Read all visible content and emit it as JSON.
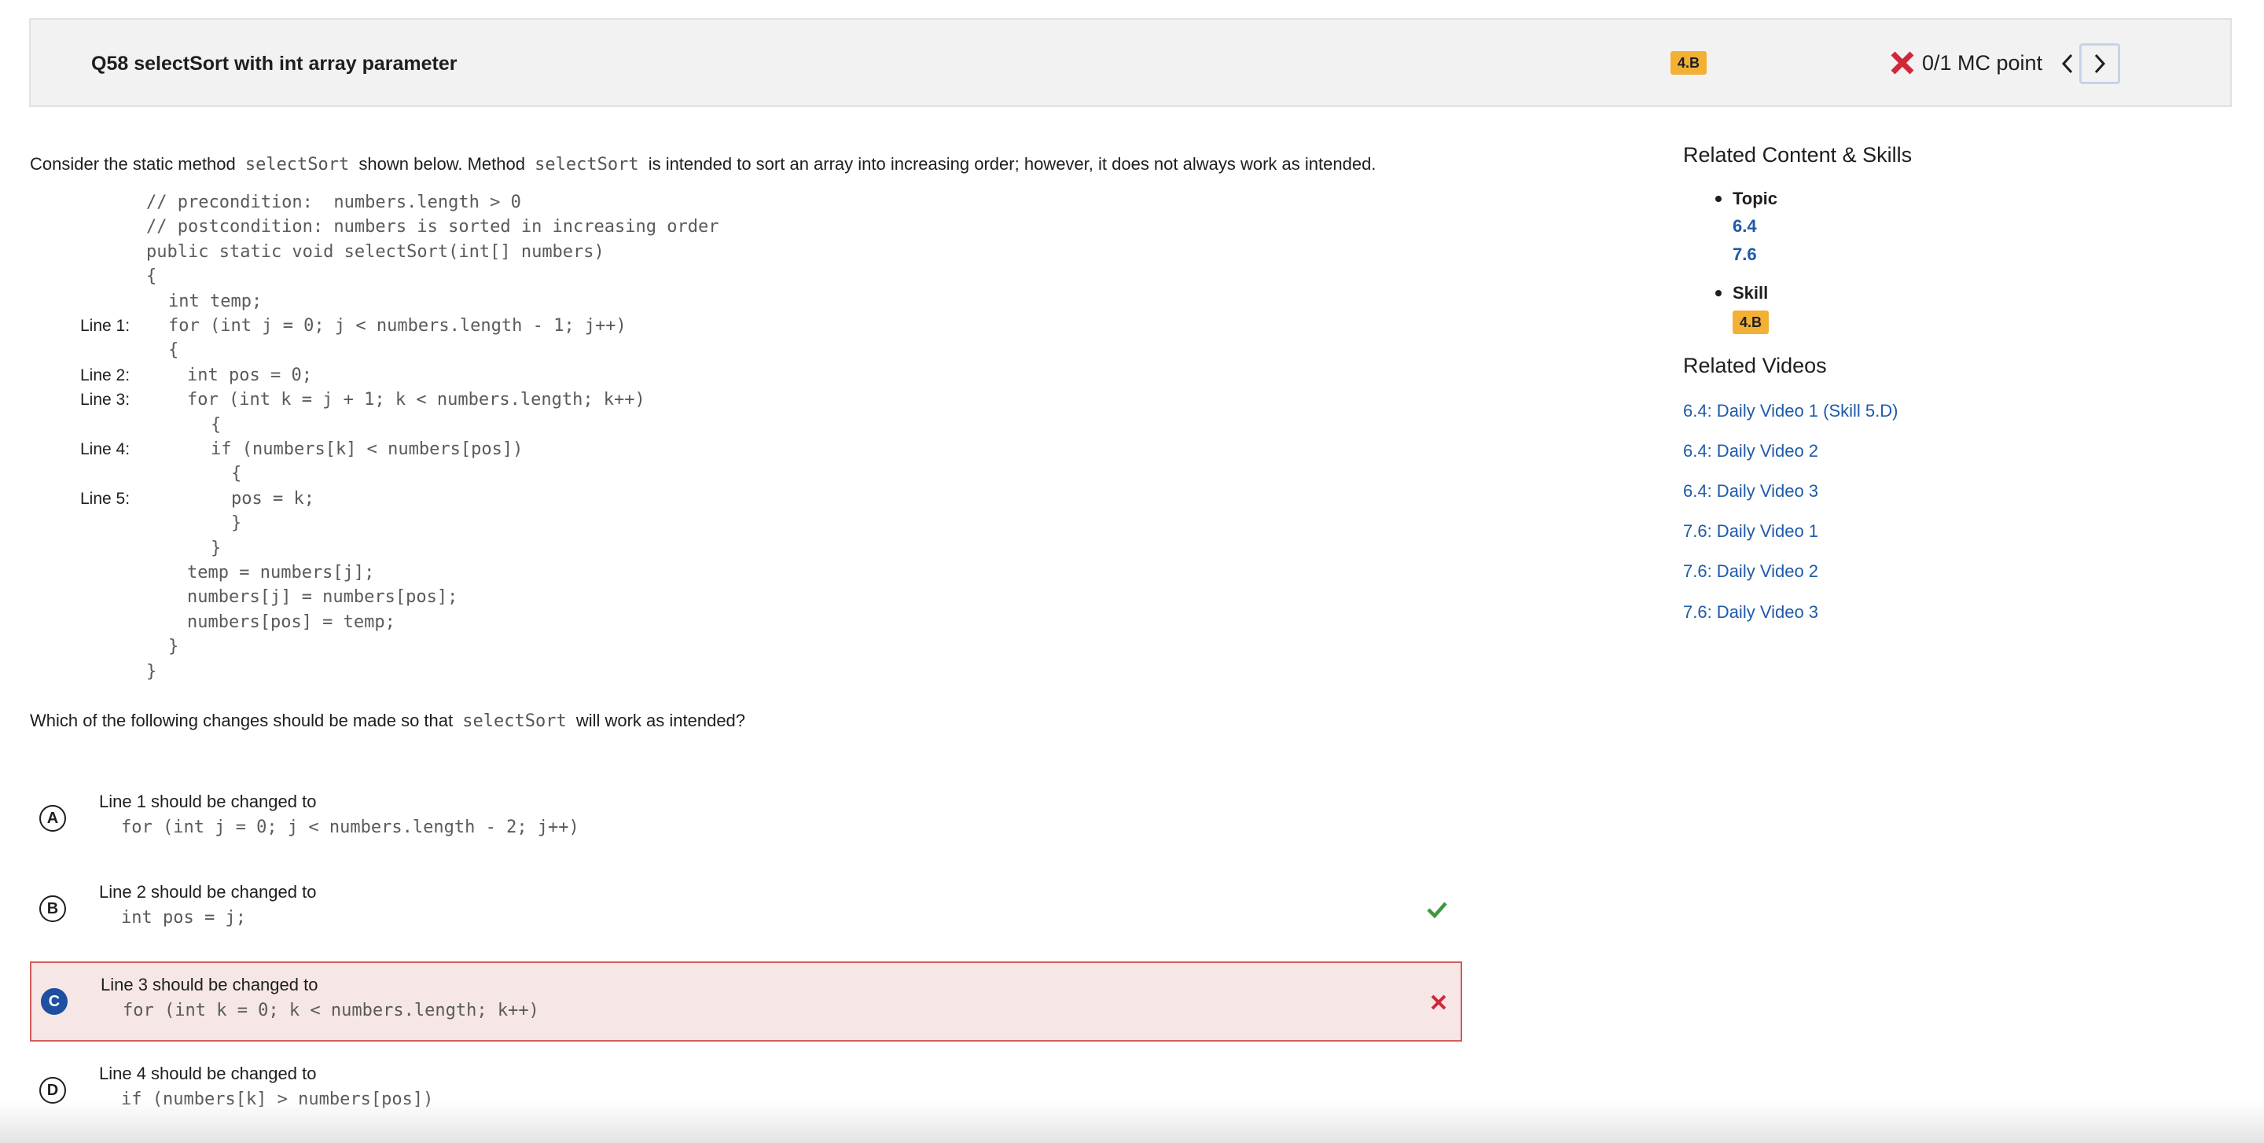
{
  "header": {
    "title": "Q58 selectSort with int array parameter",
    "skill_badge": "4.B",
    "score": "0/1 MC point"
  },
  "question": {
    "stem_before": "Consider the static method",
    "stem_code1": "selectSort",
    "stem_mid": "shown below. Method",
    "stem_code2": "selectSort",
    "stem_after": "is intended to sort an array into increasing order; however, it does not always work as intended.",
    "code_lines": [
      {
        "label": "",
        "text": "// precondition:  numbers.length > 0",
        "indent": 0
      },
      {
        "label": "",
        "text": "// postcondition: numbers is sorted in increasing order",
        "indent": 0
      },
      {
        "label": "",
        "text": "public static void selectSort(int[] numbers)",
        "indent": 0
      },
      {
        "label": "",
        "text": "{",
        "indent": 0
      },
      {
        "label": "",
        "text": "int temp;",
        "indent": 1
      },
      {
        "label": "Line 1:",
        "text": "for (int j = 0; j < numbers.length - 1; j++)",
        "indent": 1
      },
      {
        "label": "",
        "text": "{",
        "indent": 1
      },
      {
        "label": "Line 2:",
        "text": "int pos = 0;",
        "indent": 2
      },
      {
        "label": "Line 3:",
        "text": "for (int k = j + 1; k < numbers.length; k++)",
        "indent": 2
      },
      {
        "label": "",
        "text": "{",
        "indent": 3
      },
      {
        "label": "Line 4:",
        "text": "if (numbers[k] < numbers[pos])",
        "indent": 3
      },
      {
        "label": "",
        "text": "{",
        "indent": 4
      },
      {
        "label": "Line 5:",
        "text": "pos = k;",
        "indent": 4
      },
      {
        "label": "",
        "text": "}",
        "indent": 4
      },
      {
        "label": "",
        "text": "}",
        "indent": 3
      },
      {
        "label": "",
        "text": "temp = numbers[j];",
        "indent": 2
      },
      {
        "label": "",
        "text": "numbers[j] = numbers[pos];",
        "indent": 2
      },
      {
        "label": "",
        "text": "numbers[pos] = temp;",
        "indent": 2
      },
      {
        "label": "",
        "text": "}",
        "indent": 1
      },
      {
        "label": "",
        "text": "}",
        "indent": 0
      }
    ],
    "prompt_before": "Which of the following changes should be made so that",
    "prompt_code": "selectSort",
    "prompt_after": "will work as intended?"
  },
  "options": [
    {
      "letter": "A",
      "text": "Line 1 should be changed to",
      "code": "for (int j = 0; j < numbers.length - 2; j++)",
      "state": "none"
    },
    {
      "letter": "B",
      "text": "Line 2 should be changed to",
      "code": "int pos = j;",
      "state": "correct"
    },
    {
      "letter": "C",
      "text": "Line 3 should be changed to",
      "code": "for (int k = 0; k < numbers.length; k++)",
      "state": "incorrect"
    },
    {
      "letter": "D",
      "text": "Line 4 should be changed to",
      "code": "if (numbers[k] > numbers[pos])",
      "state": "none"
    }
  ],
  "sidebar": {
    "related_heading": "Related Content & Skills",
    "topic_label": "Topic",
    "topics": [
      "6.4",
      "7.6"
    ],
    "skill_label": "Skill",
    "skill_badge": "4.B",
    "videos_heading": "Related Videos",
    "videos": [
      "6.4: Daily Video 1 (Skill 5.D)",
      "6.4: Daily Video 2",
      "6.4: Daily Video 3",
      "7.6: Daily Video 1",
      "7.6: Daily Video 2",
      "7.6: Daily Video 3"
    ]
  },
  "colors": {
    "accent_blue": "#1f5aa8",
    "badge_orange": "#f2b035",
    "error_red": "#d0283a",
    "success_green": "#3a9a3a",
    "selected_bg": "#f6e6e6"
  }
}
